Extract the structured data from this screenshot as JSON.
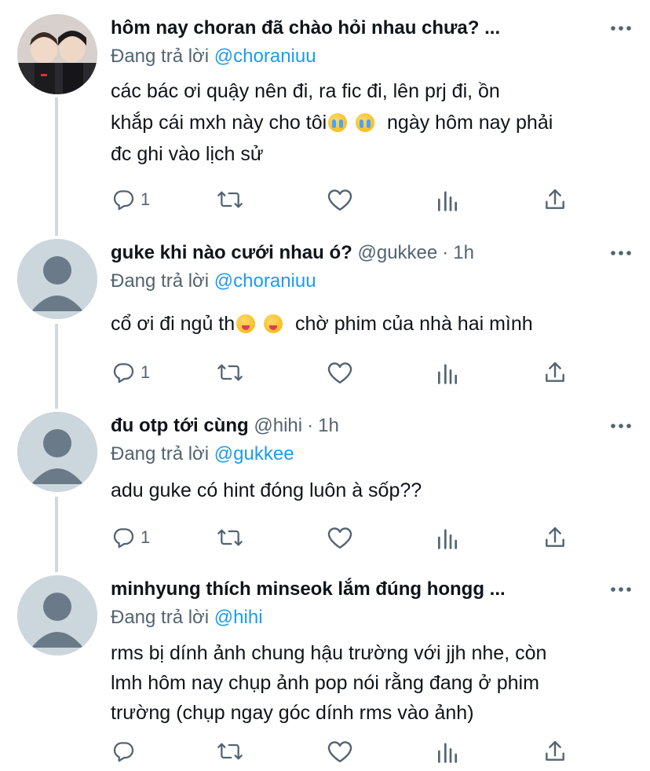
{
  "replying_prefix": "Đang trả lời",
  "tweets": [
    {
      "display_name": "hôm nay choran đã chào hỏi nhau chưa? ...",
      "handle": "",
      "time": "",
      "reply_to": "@choraniuu",
      "lines": [
        "các bác ơi quậy nên đi, ra fic đi, lên prj đi, ồn",
        "khắp cái mxh này cho tôi",
        "ngày hôm nay phải",
        "đc ghi vào lịch sử"
      ],
      "reply_count": "1"
    },
    {
      "display_name": "guke khi nào cưới nhau ó?",
      "handle": "@gukkee",
      "time": "1h",
      "reply_to": "@choraniuu",
      "lines": [
        "cổ ơi đi ngủ th",
        "chờ phim của nhà hai mình"
      ],
      "reply_count": "1"
    },
    {
      "display_name": "đu otp tới cùng",
      "handle": "@hihi",
      "time": "1h",
      "reply_to": "@gukkee",
      "lines": [
        "adu guke có hint đóng luôn à sốp??"
      ],
      "reply_count": "1"
    },
    {
      "display_name": "minhyung thích minseok lắm đúng hongg ...",
      "handle": "",
      "time": "",
      "reply_to": "@hihi",
      "lines": [
        "rms bị dính ảnh chung hậu trường với jjh nhe, còn",
        "lmh hôm nay chụp ảnh pop nói rằng đang ở phim",
        "trường (chụp ngay góc dính rms vào ảnh)"
      ],
      "reply_count": ""
    }
  ],
  "colors": {
    "accent": "#1d9bf0",
    "secondary": "#536471",
    "thread_line": "#cfd9de"
  }
}
